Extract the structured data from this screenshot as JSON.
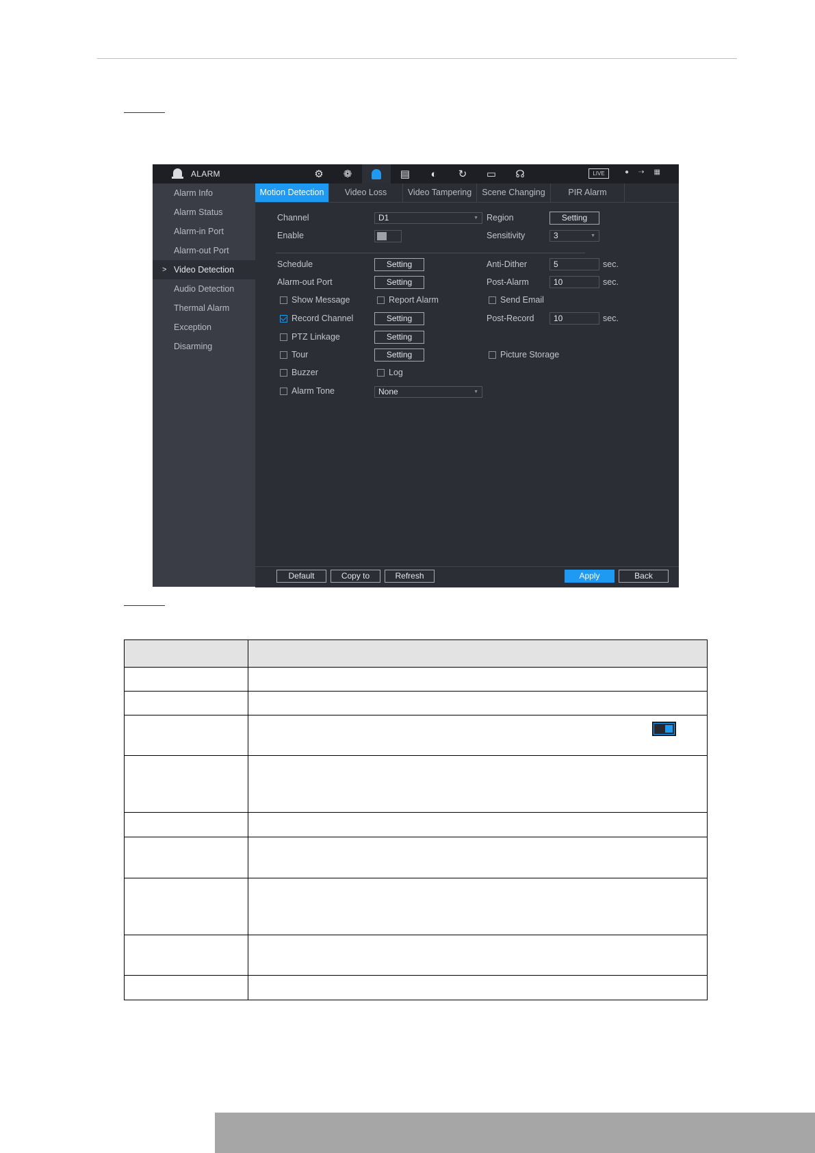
{
  "window": {
    "app_title": "ALARM",
    "nav_icons": [
      "film-reel-icon",
      "gear-icon",
      "alarm-bell-icon",
      "storage-icon",
      "gauge-icon",
      "refresh-icon",
      "monitor-icon",
      "headset-icon"
    ],
    "live_label": "LIVE",
    "top_right_icons": [
      "user-icon",
      "logout-icon",
      "grid-icon"
    ]
  },
  "sidebar": {
    "items": [
      {
        "label": "Alarm Info"
      },
      {
        "label": "Alarm Status"
      },
      {
        "label": "Alarm-in Port"
      },
      {
        "label": "Alarm-out Port"
      },
      {
        "label": "Video Detection",
        "active": true
      },
      {
        "label": "Audio Detection"
      },
      {
        "label": "Thermal Alarm"
      },
      {
        "label": "Exception"
      },
      {
        "label": "Disarming"
      }
    ],
    "active_marker": ">"
  },
  "tabs": [
    "Motion Detection",
    "Video Loss",
    "Video Tampering",
    "Scene Changing",
    "PIR Alarm"
  ],
  "form": {
    "channel_label": "Channel",
    "channel_value": "D1",
    "region_label": "Region",
    "region_button": "Setting",
    "enable_label": "Enable",
    "enable_on": false,
    "sensitivity_label": "Sensitivity",
    "sensitivity_value": "3",
    "schedule_label": "Schedule",
    "schedule_button": "Setting",
    "anti_dither_label": "Anti-Dither",
    "anti_dither_value": "5",
    "anti_dither_unit": "sec.",
    "alarm_out_label": "Alarm-out Port",
    "alarm_out_button": "Setting",
    "post_alarm_label": "Post-Alarm",
    "post_alarm_value": "10",
    "post_alarm_unit": "sec.",
    "show_message_label": "Show Message",
    "report_alarm_label": "Report Alarm",
    "send_email_label": "Send Email",
    "record_channel_label": "Record Channel",
    "record_channel_checked": true,
    "record_channel_button": "Setting",
    "post_record_label": "Post-Record",
    "post_record_value": "10",
    "post_record_unit": "sec.",
    "ptz_label": "PTZ Linkage",
    "ptz_button": "Setting",
    "tour_label": "Tour",
    "tour_button": "Setting",
    "picture_storage_label": "Picture Storage",
    "buzzer_label": "Buzzer",
    "log_label": "Log",
    "alarm_tone_label": "Alarm Tone",
    "alarm_tone_value": "None"
  },
  "bottom": {
    "default_label": "Default",
    "copy_to_label": "Copy to",
    "refresh_label": "Refresh",
    "apply_label": "Apply",
    "back_label": "Back"
  },
  "colors": {
    "accent": "#1e9af3",
    "panel": "#2b2e35",
    "sidebar": "#3a3d45"
  }
}
